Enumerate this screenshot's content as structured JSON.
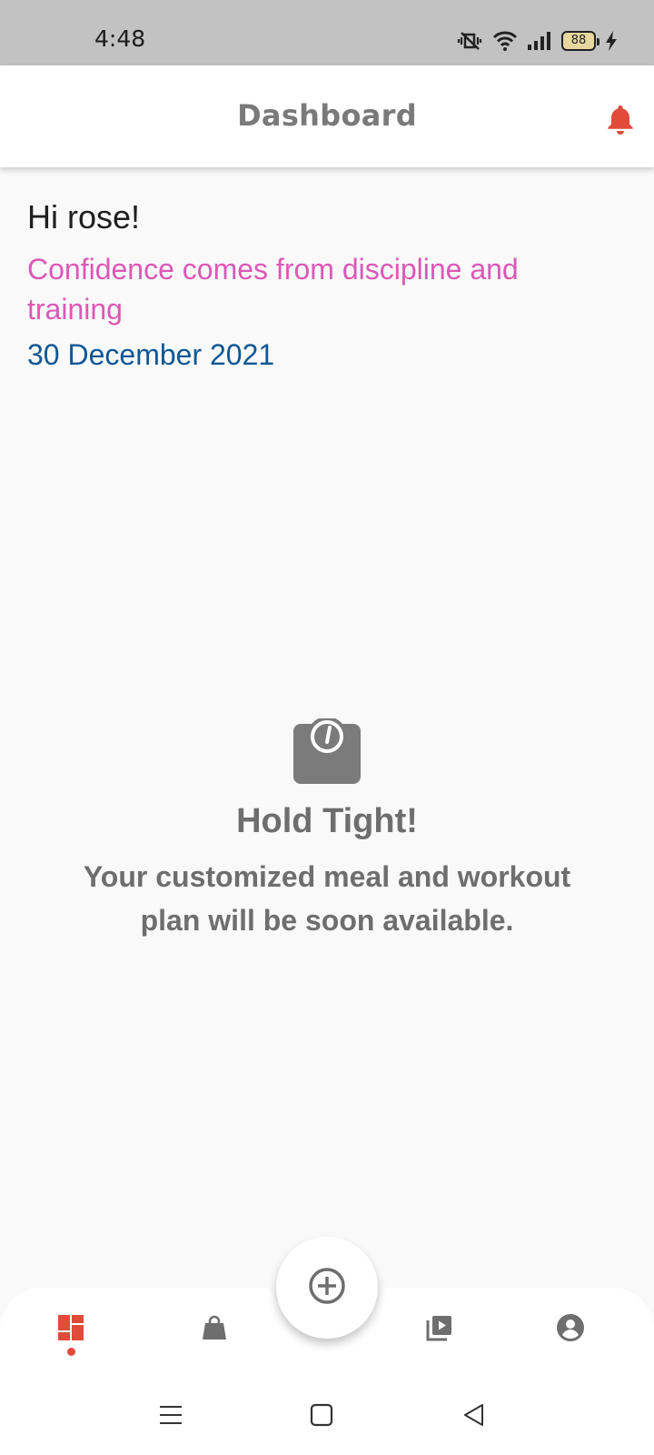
{
  "status_bar": {
    "time": "4:48",
    "battery": "88",
    "icons": [
      "vibrate-icon",
      "wifi-icon",
      "signal-icon",
      "battery-icon",
      "charging-icon"
    ]
  },
  "header": {
    "title": "Dashboard",
    "notification_icon": "bell-icon"
  },
  "greeting": {
    "hello": "Hi rose!",
    "quote": "Confidence comes from discipline and training",
    "date": "30 December 2021"
  },
  "empty_state": {
    "icon": "scale-icon",
    "title": "Hold Tight!",
    "message": "Your customized meal and workout plan will be soon available."
  },
  "bottom_nav": {
    "items": [
      {
        "icon": "dashboard-icon",
        "active": true
      },
      {
        "icon": "shopping-bag-icon",
        "active": false
      },
      {
        "icon": "add-circle-icon",
        "active": false
      },
      {
        "icon": "video-library-icon",
        "active": false
      },
      {
        "icon": "profile-icon",
        "active": false
      }
    ]
  },
  "system_nav": [
    "menu-icon",
    "home-icon",
    "back-icon"
  ],
  "colors": {
    "accent": "#e04b3a",
    "quote": "#dc58b7",
    "date": "#0e5795",
    "muted": "#6e6e6e",
    "status_bar": "#c2c2c2"
  }
}
